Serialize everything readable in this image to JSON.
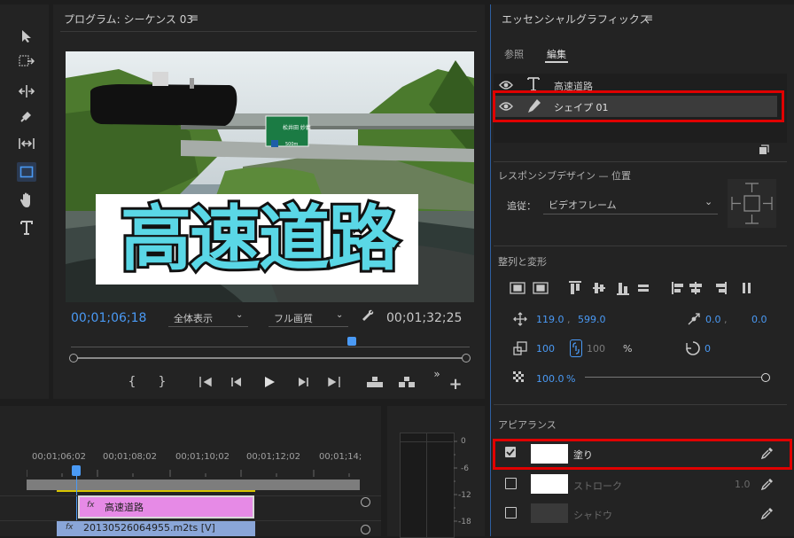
{
  "program": {
    "title": "プログラム: シーケンス 03",
    "title_overlay": "高速道路",
    "sign_text": "松井田 妙義",
    "sign_km": "500m",
    "current_time": "00;01;06;18",
    "zoom_select": "全体表示",
    "quality_select": "フル画質",
    "duration": "00;01;32;25"
  },
  "essential_graphics": {
    "title": "エッセンシャルグラフィックス",
    "tabs": [
      "参照",
      "編集"
    ],
    "layers": [
      {
        "name": "高速道路"
      },
      {
        "name": "シェイプ 01"
      }
    ],
    "responsive_design_label": "レスポンシブデザイン — 位置",
    "pin_to_label": "追従：",
    "pin_to_value": "ビデオフレーム",
    "align_transform_label": "整列と変形",
    "position_x": "119.0",
    "position_y": "599.0",
    "anchor_x": "0.0",
    "anchor_y": "0.0",
    "scale": "100",
    "scale_h": "100",
    "percent": "%",
    "rotation": "0",
    "opacity": "100.0",
    "opacity_unit": "%",
    "appearance_label": "アピアランス",
    "fill_label": "塗り",
    "stroke_label": "ストローク",
    "stroke_width": "1.0",
    "shadow_label": "シャドウ",
    "colors": {
      "accent": "#4a9af5",
      "highlight_box": "#e00000",
      "clip_title": "#e68ae6",
      "clip_video": "#8aa6d8"
    }
  },
  "timeline": {
    "timecodes": [
      "00;01;06;02",
      "00;01;08;02",
      "00;01;10;02",
      "00;01;12;02",
      "00;01;14;"
    ],
    "clip_title": "高速道路",
    "clip_video": "20130526064955.m2ts [V]",
    "fx_label": "fx"
  },
  "audio_meter": {
    "levels": [
      "0",
      "-6",
      "-12",
      "-18"
    ]
  }
}
